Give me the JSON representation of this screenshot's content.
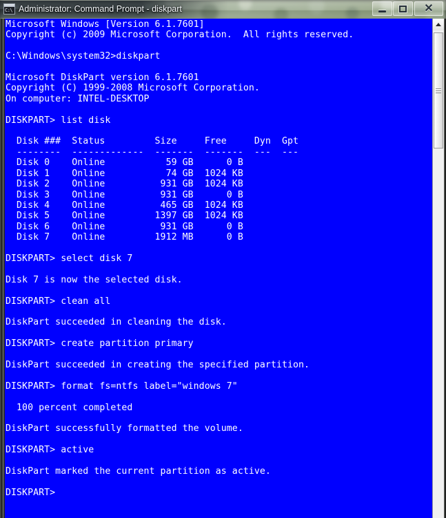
{
  "window": {
    "title": "Administrator: Command Prompt - diskpart",
    "app_icon": "command-prompt-icon",
    "icon_glyph": "C:\\",
    "console_bg": "#0000FF",
    "console_fg": "#FFFFFF",
    "buttons": {
      "minimize": "minimize",
      "maximize": "maximize",
      "close": "✕"
    }
  },
  "console": {
    "lines": [
      "Microsoft Windows [Version 6.1.7601]",
      "Copyright (c) 2009 Microsoft Corporation.  All rights reserved.",
      "",
      "C:\\Windows\\system32>diskpart",
      "",
      "Microsoft DiskPart version 6.1.7601",
      "Copyright (C) 1999-2008 Microsoft Corporation.",
      "On computer: INTEL-DESKTOP",
      "",
      "DISKPART> list disk",
      "",
      "  Disk ###  Status         Size     Free     Dyn  Gpt",
      "  --------  -------------  -------  -------  ---  ---",
      "  Disk 0    Online           59 GB      0 B",
      "  Disk 1    Online           74 GB  1024 KB",
      "  Disk 2    Online          931 GB  1024 KB",
      "  Disk 3    Online          931 GB      0 B",
      "  Disk 4    Online          465 GB  1024 KB",
      "  Disk 5    Online         1397 GB  1024 KB",
      "  Disk 6    Online          931 GB      0 B",
      "  Disk 7    Online         1912 MB      0 B",
      "",
      "DISKPART> select disk 7",
      "",
      "Disk 7 is now the selected disk.",
      "",
      "DISKPART> clean all",
      "",
      "DiskPart succeeded in cleaning the disk.",
      "",
      "DISKPART> create partition primary",
      "",
      "DiskPart succeeded in creating the specified partition.",
      "",
      "DISKPART> format fs=ntfs label=\"windows 7\"",
      "",
      "  100 percent completed",
      "",
      "DiskPart successfully formatted the volume.",
      "",
      "DISKPART> active",
      "",
      "DiskPart marked the current partition as active.",
      "",
      "DISKPART>"
    ],
    "disk_table": {
      "headers": [
        "Disk ###",
        "Status",
        "Size",
        "Free",
        "Dyn",
        "Gpt"
      ],
      "rows": [
        [
          "Disk 0",
          "Online",
          "59 GB",
          "0 B",
          "",
          ""
        ],
        [
          "Disk 1",
          "Online",
          "74 GB",
          "1024 KB",
          "",
          ""
        ],
        [
          "Disk 2",
          "Online",
          "931 GB",
          "1024 KB",
          "",
          ""
        ],
        [
          "Disk 3",
          "Online",
          "931 GB",
          "0 B",
          "",
          ""
        ],
        [
          "Disk 4",
          "Online",
          "465 GB",
          "1024 KB",
          "",
          ""
        ],
        [
          "Disk 5",
          "Online",
          "1397 GB",
          "1024 KB",
          "",
          ""
        ],
        [
          "Disk 6",
          "Online",
          "931 GB",
          "0 B",
          "",
          ""
        ],
        [
          "Disk 7",
          "Online",
          "1912 MB",
          "0 B",
          "",
          ""
        ]
      ]
    },
    "commands": [
      "list disk",
      "select disk 7",
      "clean all",
      "create partition primary",
      "format fs=ntfs label=\"windows 7\"",
      "active"
    ],
    "prompt": "DISKPART>",
    "progress": "100 percent completed"
  },
  "scrollbar": {
    "up_arrow": "scroll-up-arrow",
    "thumb": "scroll-thumb"
  }
}
